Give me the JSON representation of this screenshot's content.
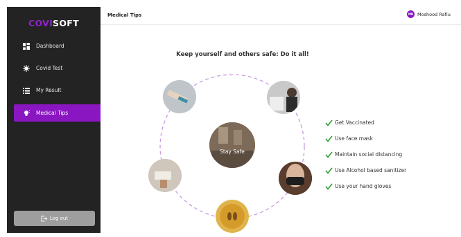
{
  "sidebar": {
    "logo": {
      "part1": "COVI",
      "part2": "SOFT"
    },
    "items": [
      {
        "label": "Dashboard",
        "icon": "dashboard-icon"
      },
      {
        "label": "Covid Test",
        "icon": "virus-icon"
      },
      {
        "label": "My Result",
        "icon": "list-icon"
      },
      {
        "label": "Medical Tips",
        "icon": "lightbulb-icon",
        "active": true
      }
    ],
    "logout_label": "Log out"
  },
  "header": {
    "title": "Medical Tips",
    "user": {
      "initials": "MR",
      "name": "Moshood Rafiu"
    }
  },
  "main": {
    "heading": "Keep yourself and others safe: Do it all!",
    "center_label": "Stay Safe",
    "tips": [
      "Get Vaccinated",
      "Use face mask",
      "Maintain social distancing",
      "Use Alcohol based sanitizer",
      "Use your hand gloves"
    ]
  },
  "colors": {
    "sidebar_bg": "#232323",
    "accent": "#8a16c2",
    "check": "#2e9e2e",
    "dashed_circle": "#c79be0"
  }
}
